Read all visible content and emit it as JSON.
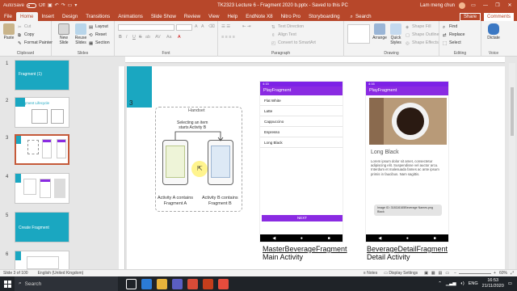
{
  "titlebar": {
    "autosave": "AutoSave",
    "autosave_state": "Off",
    "doc_title": "TK2323 Lecture 6 - Fragment 2020 b.pptx  -  Saved to this PC",
    "user": "Lam meng chun"
  },
  "tabs": [
    "File",
    "Home",
    "Insert",
    "Design",
    "Transitions",
    "Animations",
    "Slide Show",
    "Review",
    "View",
    "Help",
    "EndNote X8",
    "Nitro Pro",
    "Storyboarding"
  ],
  "active_tab": "Home",
  "search_label": "Search",
  "share_label": "Share",
  "comments_label": "Comments",
  "ribbon": {
    "clipboard": {
      "paste": "Paste",
      "cut": "Cut",
      "copy": "Copy",
      "format_painter": "Format Painter",
      "label": "Clipboard"
    },
    "slides": {
      "new_slide": "New Slide",
      "reuse_slides": "Reuse Slides",
      "layout": "Layout",
      "reset": "Reset",
      "section": "Section",
      "label": "Slides"
    },
    "font": {
      "label": "Font",
      "bold": "B",
      "italic": "I",
      "underline": "U",
      "strike": "S",
      "shadow": "ab",
      "spacing": "AV",
      "case": "Aa",
      "grow": "A",
      "shrink": "A"
    },
    "paragraph": {
      "label": "Paragraph",
      "text_direction": "Text Direction",
      "align_text": "Align Text",
      "convert_smartart": "Convert to SmartArt"
    },
    "drawing": {
      "label": "Drawing",
      "arrange": "Arrange",
      "quick_styles": "Quick Styles",
      "shape_fill": "Shape Fill",
      "shape_outline": "Shape Outline",
      "shape_effects": "Shape Effects"
    },
    "editing": {
      "label": "Editing",
      "find": "Find",
      "replace": "Replace",
      "select": "Select"
    },
    "voice": {
      "label": "Voice",
      "dictate": "Dictate"
    }
  },
  "thumbnails": [
    {
      "num": "1",
      "title": "Fragment (1)"
    },
    {
      "num": "2",
      "title": "Fragment Lifecycle"
    },
    {
      "num": "3",
      "title": ""
    },
    {
      "num": "4",
      "title": ""
    },
    {
      "num": "5",
      "title": "Create Fragment"
    },
    {
      "num": "6",
      "title": ""
    }
  ],
  "slide": {
    "number": "3",
    "diagram": {
      "handset": "Handset",
      "selecting": "Selecting an item\nstarts Activity B",
      "activity_a": "Activity A contains\nFragment A",
      "activity_b": "Activity B contains\nFragment B"
    },
    "phone_left": {
      "status_time": "4:15",
      "appbar": "PlayFragment",
      "items": [
        "Flat White",
        "Latte",
        "Cappuccino",
        "Espresso",
        "Long Black"
      ],
      "button": "NEXT"
    },
    "phone_right": {
      "status_time": "4:16",
      "appbar": "PlayFragment",
      "title": "Long Black",
      "body": "Lorem ipsum dolor sit amet, consectetur adipiscing elit. Suspendisse vel auctor arcu. Interdum et malesuada fames ac ante ipsum primis in faucibus. Nam sagittis.",
      "caption": "Image ID: 318116165Beverage Names.png Black"
    },
    "caption_left": {
      "line1": "MasterBeverageFragment",
      "line2": "Main Activity"
    },
    "caption_right": {
      "line1": "BeverageDetailFragment",
      "line2": "Detail Activity"
    }
  },
  "statusbar": {
    "slide_info": "Slide 3 of 100",
    "language": "English (United Kingdom)",
    "notes": "Notes",
    "display_settings": "Display Settings",
    "zoom": "60%"
  },
  "taskbar": {
    "search": "Search",
    "lang": "ENG",
    "time": "16:53",
    "date": "21/11/2020"
  },
  "colors": {
    "accent": "#b7472a",
    "cyan": "#1aa7c1",
    "purple": "#8a2be2"
  }
}
